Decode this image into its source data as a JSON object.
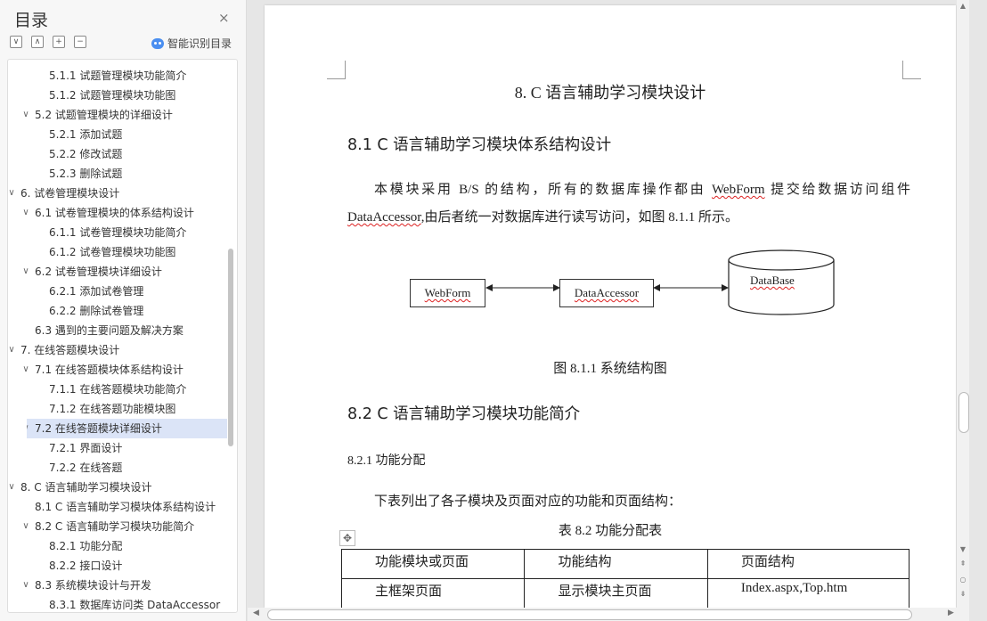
{
  "nav": {
    "title": "目录",
    "close_symbol": "×",
    "tools": [
      "∨",
      "∧",
      "+",
      "−"
    ],
    "smart_label": "智能识别目录",
    "items": [
      {
        "text": "5.1.1  试题管理模块功能简介",
        "level": 3,
        "chev": ""
      },
      {
        "text": "5.1.2  试题管理模块功能图",
        "level": 3,
        "chev": ""
      },
      {
        "text": "5.2  试题管理模块的详细设计",
        "level": 2,
        "chev": "∨"
      },
      {
        "text": "5.2.1  添加试题",
        "level": 3,
        "chev": ""
      },
      {
        "text": "5.2.2  修改试题",
        "level": 3,
        "chev": ""
      },
      {
        "text": "5.2.3  删除试题",
        "level": 3,
        "chev": ""
      },
      {
        "text": "6.  试卷管理模块设计",
        "level": 1,
        "chev": "∨"
      },
      {
        "text": "6.1 试卷管理模块的体系结构设计",
        "level": 2,
        "chev": "∨"
      },
      {
        "text": "6.1.1  试卷管理模块功能简介",
        "level": 3,
        "chev": ""
      },
      {
        "text": "6.1.2  试卷管理模块功能图",
        "level": 3,
        "chev": ""
      },
      {
        "text": "6.2  试卷管理模块详细设计",
        "level": 2,
        "chev": "∨"
      },
      {
        "text": "6.2.1  添加试卷管理",
        "level": 3,
        "chev": ""
      },
      {
        "text": "6.2.2  删除试卷管理",
        "level": 3,
        "chev": ""
      },
      {
        "text": "6.3  遇到的主要问题及解决方案",
        "level": 2,
        "chev": ""
      },
      {
        "text": "7.  在线答题模块设计",
        "level": 1,
        "chev": "∨"
      },
      {
        "text": "7.1  在线答题模块体系结构设计",
        "level": 2,
        "chev": "∨"
      },
      {
        "text": "7.1.1  在线答题模块功能简介",
        "level": 3,
        "chev": ""
      },
      {
        "text": "7.1.2  在线答题功能模块图",
        "level": 3,
        "chev": ""
      },
      {
        "text": "7.2  在线答题模块详细设计",
        "level": 2,
        "chev": "∨",
        "active": true
      },
      {
        "text": "7.2.1  界面设计",
        "level": 3,
        "chev": ""
      },
      {
        "text": "7.2.2  在线答题",
        "level": 3,
        "chev": ""
      },
      {
        "text": "8. C 语言辅助学习模块设计",
        "level": 1,
        "chev": "∨"
      },
      {
        "text": "8.1 C 语言辅助学习模块体系结构设计",
        "level": 2,
        "chev": ""
      },
      {
        "text": "8.2 C 语言辅助学习模块功能简介",
        "level": 2,
        "chev": "∨"
      },
      {
        "text": "8.2.1  功能分配",
        "level": 3,
        "chev": ""
      },
      {
        "text": "8.2.2  接口设计",
        "level": 3,
        "chev": ""
      },
      {
        "text": "8.3  系统模块设计与开发",
        "level": 2,
        "chev": "∨"
      },
      {
        "text": "8.3.1  数据库访问类 DataAccessor",
        "level": 3,
        "chev": ""
      }
    ]
  },
  "doc": {
    "chapter_title": "8. C 语言辅助学习模块设计",
    "sec1_title": "8.1 C 语言辅助学习模块体系结构设计",
    "para1_a": "本模块采用 B/S 的结构，所有的数据库操作都由 ",
    "para1_webform": "WebForm",
    "para1_b": " 提交给数据访问组件",
    "para1_dataaccessor": "DataAccessor",
    "para1_c": ",由后者统一对数据库进行读写访问，如图 8.1.1 所示。",
    "diagram": {
      "box1": "WebForm",
      "box2": "DataAccessor",
      "db": "DataBase"
    },
    "fig_caption": "图 8.1.1  系统结构图",
    "sec2_title": "8.2 C 语言辅助学习模块功能简介",
    "sub1_title": "8.2.1  功能分配",
    "para2": "下表列出了各子模块及页面对应的功能和页面结构：",
    "table_caption": "表 8.2  功能分配表",
    "table": {
      "headers": [
        "功能模块或页面",
        "功能结构",
        "页面结构"
      ],
      "row1": [
        "主框架页面",
        "显示模块主页面",
        "Index.aspx,Top.htm"
      ]
    },
    "move_symbol": "✥"
  }
}
